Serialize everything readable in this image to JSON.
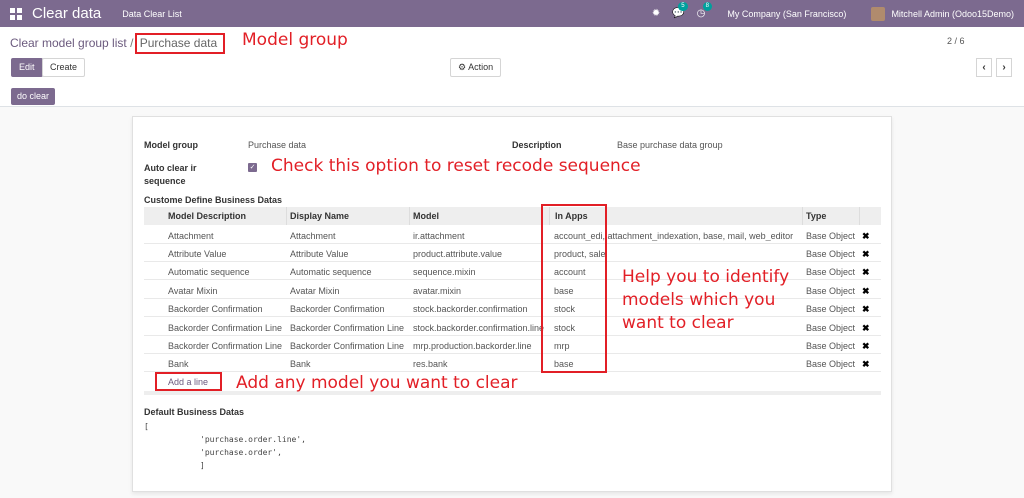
{
  "navbar": {
    "app_name": "Clear data",
    "menu_item": "Data Clear List",
    "chat_badge": "5",
    "activity_badge": "8",
    "company": "My Company (San Francisco)",
    "user": "Mitchell Admin (Odoo15Demo)",
    "bg_color": "#7c6a8f"
  },
  "control_panel": {
    "breadcrumb_parent": "Clear model group list",
    "breadcrumb_sep": "/",
    "breadcrumb_current": "Purchase data",
    "edit_label": "Edit",
    "create_label": "Create",
    "action_label": "Action",
    "pager": "2 / 6",
    "do_clear_label": "do clear"
  },
  "form": {
    "model_group_label": "Model group",
    "model_group_value": "Purchase data",
    "description_label": "Description",
    "description_value": "Base purchase data group",
    "auto_clear_label_1": "Auto clear ir",
    "auto_clear_label_2": "sequence",
    "auto_clear_checked": true,
    "section_custom": "Custome Define Business Datas",
    "columns": {
      "model_description": "Model Description",
      "display_name": "Display Name",
      "model": "Model",
      "in_apps": "In Apps",
      "type": "Type"
    },
    "rows": [
      {
        "desc": "Attachment",
        "display": "Attachment",
        "model": "ir.attachment",
        "apps": "account_edi, attachment_indexation, base, mail, web_editor",
        "type": "Base Object"
      },
      {
        "desc": "Attribute Value",
        "display": "Attribute Value",
        "model": "product.attribute.value",
        "apps": "product, sale",
        "type": "Base Object"
      },
      {
        "desc": "Automatic sequence",
        "display": "Automatic sequence",
        "model": "sequence.mixin",
        "apps": "account",
        "type": "Base Object"
      },
      {
        "desc": "Avatar Mixin",
        "display": "Avatar Mixin",
        "model": "avatar.mixin",
        "apps": "base",
        "type": "Base Object"
      },
      {
        "desc": "Backorder Confirmation",
        "display": "Backorder Confirmation",
        "model": "stock.backorder.confirmation",
        "apps": "stock",
        "type": "Base Object"
      },
      {
        "desc": "Backorder Confirmation Line",
        "display": "Backorder Confirmation Line",
        "model": "stock.backorder.confirmation.line",
        "apps": "stock",
        "type": "Base Object"
      },
      {
        "desc": "Backorder Confirmation Line",
        "display": "Backorder Confirmation Line",
        "model": "mrp.production.backorder.line",
        "apps": "mrp",
        "type": "Base Object"
      },
      {
        "desc": "Bank",
        "display": "Bank",
        "model": "res.bank",
        "apps": "base",
        "type": "Base Object"
      }
    ],
    "add_line": "Add a line",
    "section_default": "Default Business Datas",
    "default_lines": [
      "[",
      "'purchase.order.line',",
      "'purchase.order',",
      "]"
    ]
  },
  "annotations": {
    "model_group": "Model group",
    "check_option": "Check this option to reset recode sequence",
    "help_identify_1": "Help you to identify",
    "help_identify_2": "models which you",
    "help_identify_3": "want to clear",
    "add_model": "Add any model you want to clear",
    "annotation_color": "#e21f26"
  }
}
